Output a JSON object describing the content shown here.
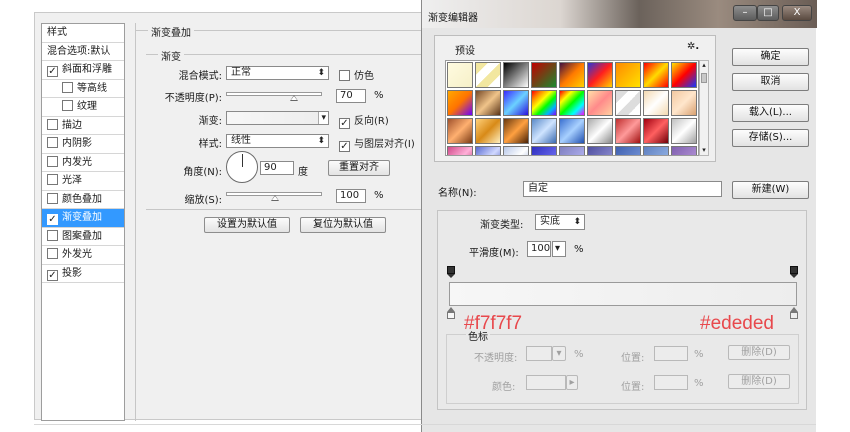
{
  "layer_style": {
    "style_list": [
      {
        "label": "样式",
        "checkbox": false,
        "checked": false,
        "sub": false,
        "active": false
      },
      {
        "label": "混合选项:默认",
        "checkbox": false,
        "checked": false,
        "sub": false,
        "active": false
      },
      {
        "label": "斜面和浮雕",
        "checkbox": true,
        "checked": true,
        "sub": false,
        "active": false
      },
      {
        "label": "等高线",
        "checkbox": true,
        "checked": false,
        "sub": true,
        "active": false
      },
      {
        "label": "纹理",
        "checkbox": true,
        "checked": false,
        "sub": true,
        "active": false
      },
      {
        "label": "描边",
        "checkbox": true,
        "checked": false,
        "sub": false,
        "active": false
      },
      {
        "label": "内阴影",
        "checkbox": true,
        "checked": false,
        "sub": false,
        "active": false
      },
      {
        "label": "内发光",
        "checkbox": true,
        "checked": false,
        "sub": false,
        "active": false
      },
      {
        "label": "光泽",
        "checkbox": true,
        "checked": false,
        "sub": false,
        "active": false
      },
      {
        "label": "颜色叠加",
        "checkbox": true,
        "checked": false,
        "sub": false,
        "active": false
      },
      {
        "label": "渐变叠加",
        "checkbox": true,
        "checked": true,
        "sub": false,
        "active": true
      },
      {
        "label": "图案叠加",
        "checkbox": true,
        "checked": false,
        "sub": false,
        "active": false
      },
      {
        "label": "外发光",
        "checkbox": true,
        "checked": false,
        "sub": false,
        "active": false
      },
      {
        "label": "投影",
        "checkbox": true,
        "checked": true,
        "sub": false,
        "active": false
      }
    ],
    "gradient_overlay": {
      "section_title": "渐变叠加",
      "group_title": "渐变",
      "blend_mode_label": "混合模式:",
      "blend_mode_value": "正常",
      "dither_label": "仿色",
      "dither_checked": false,
      "opacity_label": "不透明度(P):",
      "opacity_value": "70",
      "opacity_fraction": 0.7,
      "percent": "%",
      "gradient_label": "渐变:",
      "reverse_label": "反向(R)",
      "reverse_checked": true,
      "style_label": "样式:",
      "style_value": "线性",
      "align_label": "与图层对齐(I)",
      "align_checked": true,
      "angle_label": "角度(N):",
      "angle_value": "90",
      "angle_unit": "度",
      "reset_align_label": "重置对齐",
      "scale_label": "缩放(S):",
      "scale_value": "100",
      "scale_fraction": 0.5,
      "set_default_label": "设置为默认值",
      "reset_default_label": "复位为默认值"
    }
  },
  "gradient_editor": {
    "title": "渐变编辑器",
    "window_buttons": {
      "minimize": "–",
      "maximize": "□",
      "close": "X"
    },
    "presets_label": "预设",
    "gear_icon": "✲.",
    "ok_label": "确定",
    "cancel_label": "取消",
    "load_label": "载入(L)...",
    "save_label": "存储(S)...",
    "name_label": "名称(N):",
    "name_value": "自定",
    "new_label": "新建(W)",
    "type_label": "渐变类型:",
    "type_value": "实底",
    "smooth_label": "平滑度(M):",
    "smooth_value": "100",
    "percent": "%",
    "stop_color_left": "#f7f7f7",
    "stop_color_right": "#ededed",
    "stops_title": "色标",
    "stop_opacity_label": "不透明度:",
    "stop_color_label": "颜色:",
    "location_label": "位置:",
    "delete_label": "删除(D)",
    "presets": [
      "linear-gradient(135deg,#fffbe0,#f6f0c8)",
      "linear-gradient(135deg,#f2e7a0 25%,#fff 25%,#fff 50%,#f2e7a0 50%,#f2e7a0 75%,#fff 75%)",
      "linear-gradient(135deg,#000,#fff)",
      "linear-gradient(135deg,#c00000,#1a8a2e)",
      "linear-gradient(135deg,#401040,#ff7a00,#ffd000)",
      "linear-gradient(135deg,#2a36d6,#ff1e1e,#ffd200)",
      "linear-gradient(135deg,#ff8a00,#ffe100)",
      "linear-gradient(135deg,#ff0000,#ffdb00,#ff0000)",
      "linear-gradient(135deg,#ffe200,#ff0000,#1438ff)",
      "linear-gradient(135deg,#ffa800,#ff7300,#6a00ff)",
      "linear-gradient(135deg,#784a28,#f0c48a,#5a3418)",
      "linear-gradient(135deg,#3a2aff,#6bd1ff,#2a0fdd)",
      "linear-gradient(135deg,#ff0000,#ff8a00,#ffff00,#00ff00,#00b4ff,#8a00ff)",
      "linear-gradient(135deg,#ff0000,#ffff00,#00ff00,#00ffff,#ff00ff)",
      "linear-gradient(135deg,#ffe0a8,#ff8a8a 50%,#ffd0a0)",
      "linear-gradient(135deg,#ddd 25%,#fff 25%,#fff 50%,#ddd 50%,#ddd 75%,#fff 75%)",
      "linear-gradient(135deg,#f4d9b0,#fff,#f4d9b0)",
      "linear-gradient(135deg,#f2c8a0,#ffe6cc,#d8a070)",
      "linear-gradient(135deg,#a0522d,#ffb070,#7a3a14)",
      "linear-gradient(135deg,#ffd07a,#d88a18,#fff0c0)",
      "linear-gradient(135deg,#6a3a10,#ffa040,#4a2206)",
      "linear-gradient(135deg,#5a8ac8,#cfe4ff,#3a6ab0)",
      "linear-gradient(135deg,#3a70d0,#a8d0ff,#2050b0)",
      "linear-gradient(135deg,#aaa,#fff,#888)",
      "linear-gradient(135deg,#c03030,#ff9a9a,#a01010)",
      "linear-gradient(135deg,#a00010,#ff6060,#700008)",
      "linear-gradient(135deg,#c0c0c0,#fff,#a0a0a0)",
      "linear-gradient(135deg,#d04a8a,#ffb0d8,#a82060)",
      "linear-gradient(135deg,#5a6ad0,#d0d8ff,#3a48b0)",
      "linear-gradient(135deg,#b8c8e8,#fff,#8aa0d0)",
      "linear-gradient(135deg,#3030c0,#8080ff)",
      "linear-gradient(135deg,#8080c0,#c0c0ff)",
      "linear-gradient(135deg,#5050a0,#a0a0e0)",
      "linear-gradient(135deg,#4060b0,#80a0e0)",
      "linear-gradient(135deg,#6080c0,#a0c0f0)",
      "linear-gradient(135deg,#8060b0,#c0a0e0)",
      "linear-gradient(135deg,#a04080,#e080c0)",
      "linear-gradient(135deg,#6040a0,#a080e0)",
      "linear-gradient(135deg,#304080,#7080c0)",
      "linear-gradient(135deg,#5070b0,#90b0f0)"
    ]
  }
}
